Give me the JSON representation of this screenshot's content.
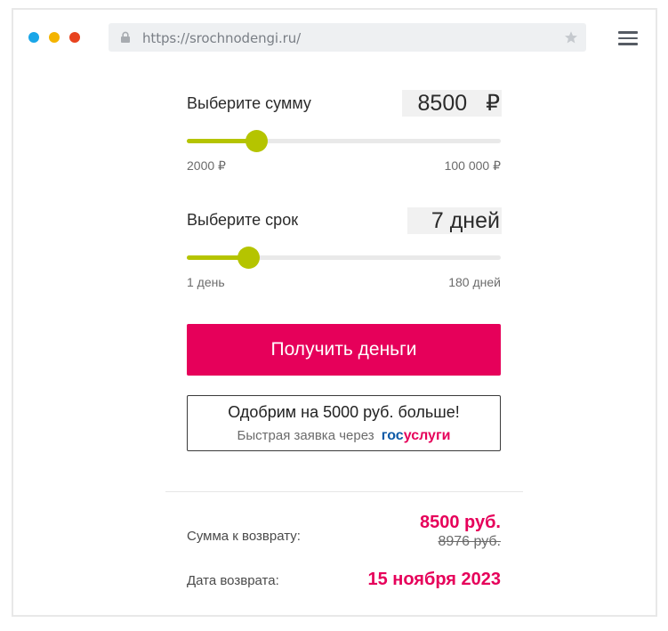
{
  "browser": {
    "dots": [
      {
        "name": "blue",
        "color": "#1aa6e8"
      },
      {
        "name": "yellow",
        "color": "#f4b400"
      },
      {
        "name": "red",
        "color": "#e8431f"
      }
    ],
    "url": "https://srochnodengi.ru/",
    "icons": {
      "lock": "lock-icon",
      "star": "star-icon",
      "menu": "hamburger-menu-icon"
    }
  },
  "amount": {
    "label": "Выберите сумму",
    "value": "8500",
    "currency": "₽",
    "min_label": "2000 ₽",
    "max_label": "100 000 ₽",
    "min": 2000,
    "max": 100000,
    "current": 8500
  },
  "term": {
    "label": "Выберите срок",
    "value": "7 дней",
    "min_label": "1 день",
    "max_label": "180 дней",
    "min": 1,
    "max": 180,
    "current": 7
  },
  "cta": {
    "label": "Получить деньги"
  },
  "gosuslugi": {
    "title": "Одобрим на 5000 руб. больше!",
    "subtitle": "Быстрая заявка через",
    "logo_part1": "гос",
    "logo_part2": "услуги"
  },
  "summary": {
    "sum_label": "Сумма к возврату:",
    "sum_value": "8500 руб.",
    "sum_old": "8976 руб.",
    "date_label": "Дата возврата:",
    "date_value": "15 ноября 2023"
  },
  "colors": {
    "accent": "#e6005a",
    "slider": "#b5c400",
    "gos_blue": "#0d5aa7"
  }
}
